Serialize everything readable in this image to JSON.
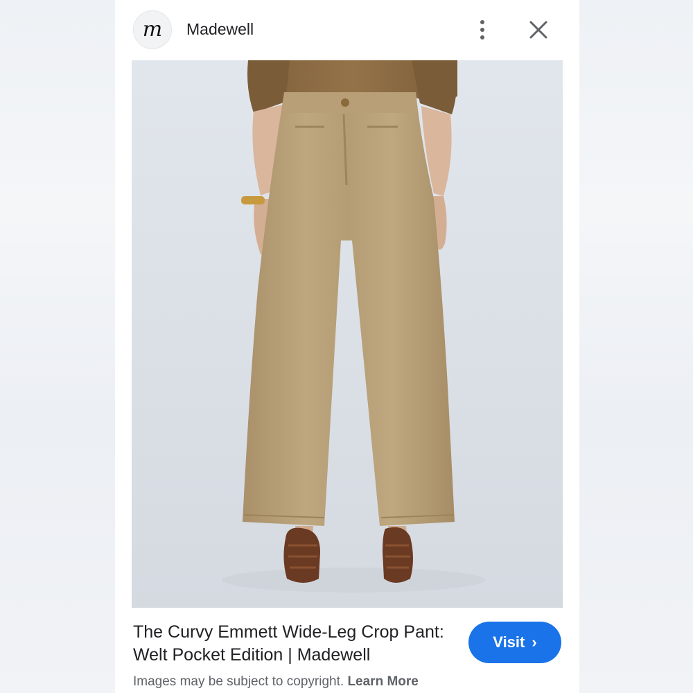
{
  "header": {
    "logo_letter": "m",
    "site_name": "Madewell",
    "more_icon": "more-vert-icon",
    "close_icon": "close-icon"
  },
  "image": {
    "subject": "wide-leg-crop-pant-photo"
  },
  "result": {
    "title": "The Curvy Emmett Wide-Leg Crop Pant: Welt Pocket Edition | Madewell",
    "visit_label": "Visit",
    "visit_chevron": "›",
    "copyright_note": "Images may be subject to copyright.",
    "learn_more": "Learn More"
  },
  "colors": {
    "accent": "#1a73e8",
    "pants": "#b9a27b",
    "shirt": "#8a6a43",
    "backdrop": "#dde2e8"
  }
}
